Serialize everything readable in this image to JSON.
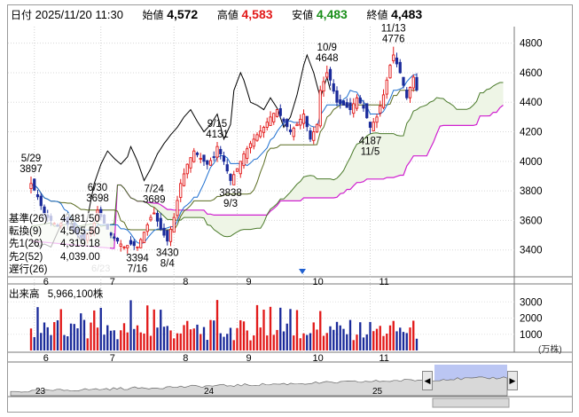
{
  "header": {
    "date_label": "日付",
    "date_value": "2025/11/20 11:30",
    "open_label": "始値",
    "open_value": "4,572",
    "high_label": "高値",
    "high_value": "4,583",
    "low_label": "安値",
    "low_value": "4,483",
    "close_label": "終値",
    "close_value": "4,483"
  },
  "legend": [
    {
      "label": "基準(26)",
      "value": "4,481.50",
      "color": "#5a6b20"
    },
    {
      "label": "転換(9)",
      "value": "4,505.50",
      "color": "#1e6fd0"
    },
    {
      "label": "先1(26)",
      "value": "4,319.18",
      "color": "#4a7a2a"
    },
    {
      "label": "先2(52)",
      "value": "4,039.00",
      "color": "#d020d0"
    },
    {
      "label": "遅行(26)",
      "value": "",
      "color": "#000000"
    }
  ],
  "volume": {
    "label": "出来高",
    "value": "5,966,100株",
    "unit": "(万株)"
  },
  "colors": {
    "up": "#e21a1a",
    "down": "#1a2a9a",
    "kijun": "#5a6b20",
    "tenkan": "#1e6fd0",
    "senkou1": "#4a7a2a",
    "senkou2": "#d020d0",
    "chikou": "#000000",
    "cloud": "#eef5e6"
  },
  "chart_data": {
    "type": "candlestick",
    "price_axis": {
      "ticks": [
        3400,
        3600,
        3800,
        4000,
        4200,
        4400,
        4600,
        4800
      ],
      "ylim": [
        3230,
        4900
      ]
    },
    "volume_axis": {
      "ticks": [
        1000,
        2000,
        3000
      ],
      "ylim": [
        0,
        3400
      ]
    },
    "month_labels": [
      {
        "label": "6",
        "day": 1
      },
      {
        "label": "7",
        "day": 21
      },
      {
        "label": "8",
        "day": 43
      },
      {
        "label": "9",
        "day": 62
      },
      {
        "label": "10",
        "day": 82
      },
      {
        "label": "11",
        "day": 102
      }
    ],
    "last_day": 116,
    "future_days": 26,
    "annotations": [
      {
        "text": "5/29",
        "value": "3897",
        "day": 0,
        "price": 3897,
        "pos": "above"
      },
      {
        "text": "6/30",
        "value": "3698",
        "day": 20,
        "price": 3698,
        "pos": "above"
      },
      {
        "text": "7/24",
        "value": "3689",
        "day": 37,
        "price": 3689,
        "pos": "above"
      },
      {
        "text": "9/15",
        "value": "4131",
        "day": 56,
        "price": 4131,
        "pos": "above"
      },
      {
        "text": "10/9",
        "value": "4648",
        "day": 89,
        "price": 4648,
        "pos": "above"
      },
      {
        "text": "11/13",
        "value": "4776",
        "day": 109,
        "price": 4776,
        "pos": "above"
      },
      {
        "text": "3394",
        "value": "7/16",
        "day": 32,
        "price": 3394,
        "pos": "below"
      },
      {
        "text": "3430",
        "value": "8/4",
        "day": 41,
        "price": 3430,
        "pos": "below"
      },
      {
        "text": "3838",
        "value": "9/3",
        "day": 60,
        "price": 3838,
        "pos": "below"
      },
      {
        "text": "4187",
        "value": "11/5",
        "day": 102,
        "price": 4187,
        "pos": "below"
      }
    ],
    "chikou_label": "6/23",
    "key_closes": [
      [
        0,
        3850
      ],
      [
        2,
        3760
      ],
      [
        4,
        3640
      ],
      [
        6,
        3600
      ],
      [
        8,
        3560
      ],
      [
        10,
        3600
      ],
      [
        13,
        3520
      ],
      [
        16,
        3470
      ],
      [
        19,
        3580
      ],
      [
        20,
        3670
      ],
      [
        22,
        3580
      ],
      [
        24,
        3500
      ],
      [
        26,
        3460
      ],
      [
        28,
        3420
      ],
      [
        30,
        3440
      ],
      [
        32,
        3420
      ],
      [
        34,
        3520
      ],
      [
        36,
        3620
      ],
      [
        37,
        3650
      ],
      [
        39,
        3540
      ],
      [
        41,
        3460
      ],
      [
        43,
        3620
      ],
      [
        45,
        3850
      ],
      [
        47,
        3980
      ],
      [
        49,
        4070
      ],
      [
        51,
        4020
      ],
      [
        53,
        3980
      ],
      [
        55,
        4030
      ],
      [
        56,
        4100
      ],
      [
        58,
        4000
      ],
      [
        60,
        3870
      ],
      [
        62,
        3950
      ],
      [
        64,
        4050
      ],
      [
        66,
        4120
      ],
      [
        68,
        4180
      ],
      [
        70,
        4230
      ],
      [
        72,
        4300
      ],
      [
        74,
        4350
      ],
      [
        76,
        4270
      ],
      [
        78,
        4200
      ],
      [
        80,
        4250
      ],
      [
        82,
        4320
      ],
      [
        84,
        4150
      ],
      [
        86,
        4250
      ],
      [
        87,
        4480
      ],
      [
        89,
        4600
      ],
      [
        90,
        4550
      ],
      [
        92,
        4400
      ],
      [
        94,
        4380
      ],
      [
        96,
        4350
      ],
      [
        98,
        4430
      ],
      [
        100,
        4360
      ],
      [
        102,
        4230
      ],
      [
        104,
        4300
      ],
      [
        106,
        4450
      ],
      [
        108,
        4650
      ],
      [
        109,
        4720
      ],
      [
        111,
        4600
      ],
      [
        113,
        4430
      ],
      [
        115,
        4570
      ],
      [
        116,
        4483
      ]
    ]
  }
}
